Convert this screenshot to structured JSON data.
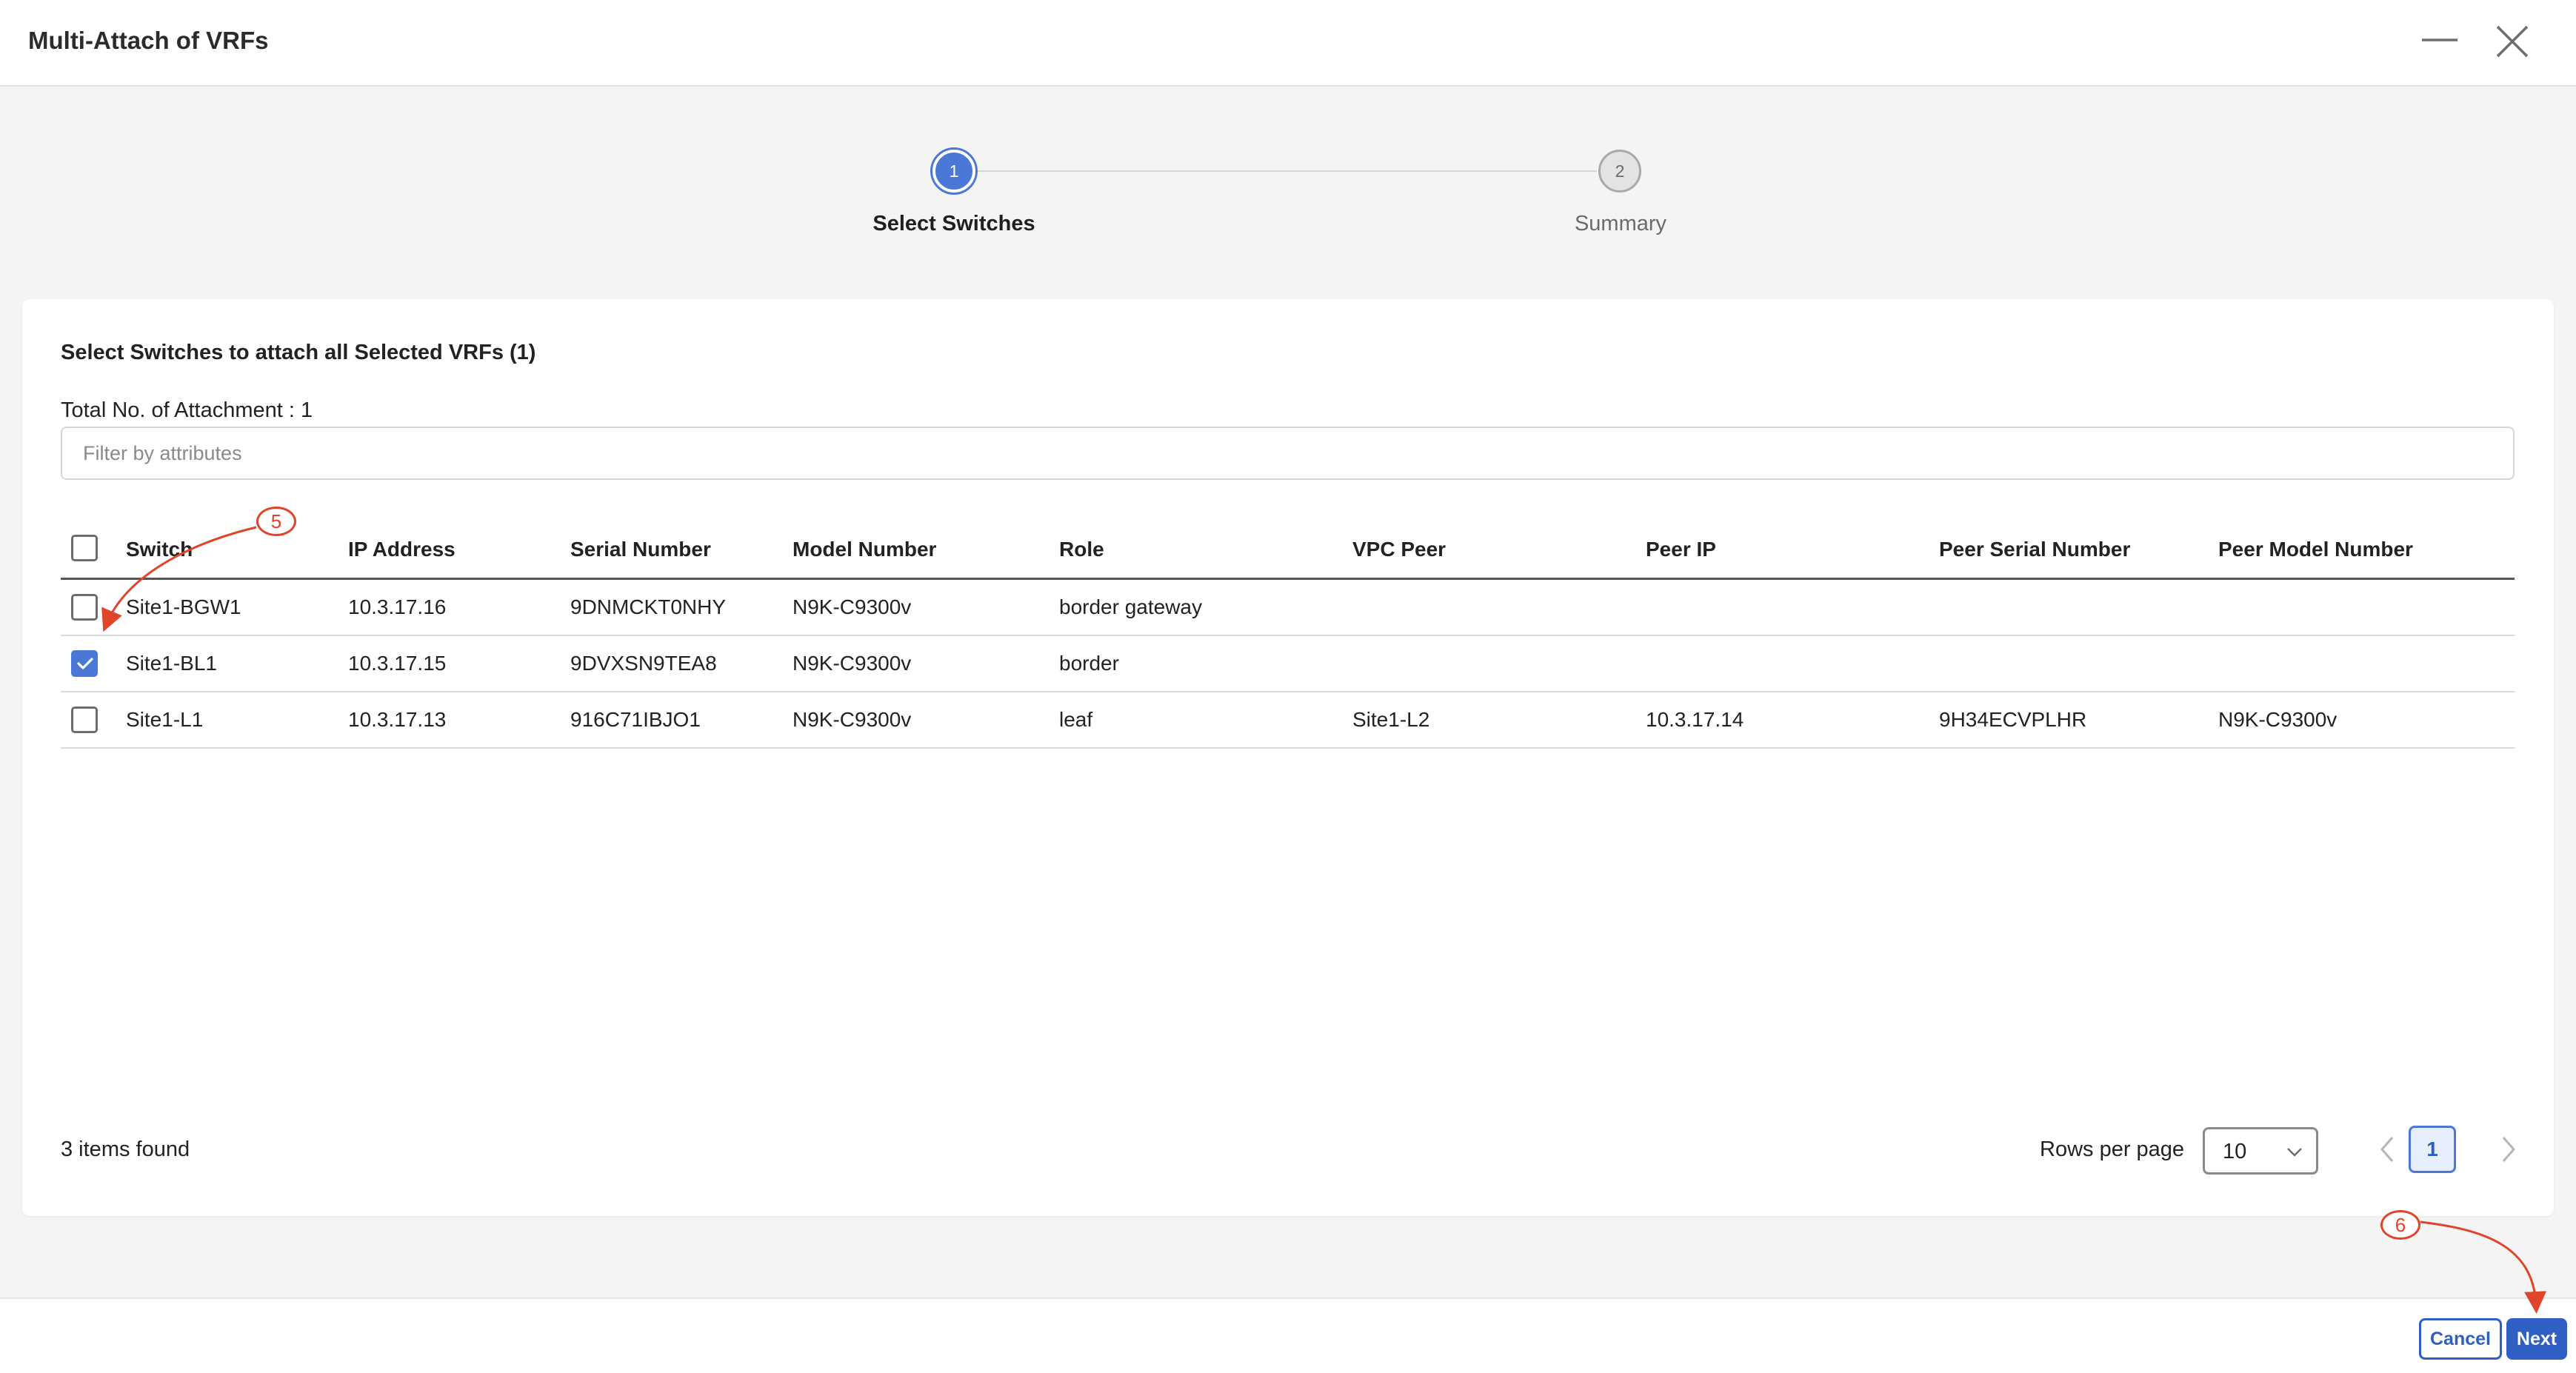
{
  "dialog": {
    "title": "Multi-Attach of VRFs",
    "minimize_icon": "minimize-icon",
    "close_icon": "close-icon"
  },
  "stepper": {
    "steps": [
      {
        "number": "1",
        "label": "Select Switches",
        "state": "active"
      },
      {
        "number": "2",
        "label": "Summary",
        "state": "pending"
      }
    ]
  },
  "panel": {
    "heading": "Select Switches to attach all Selected VRFs (1)",
    "total_attachments": "Total No. of Attachment : 1",
    "filter_placeholder": "Filter by attributes",
    "filter_value": ""
  },
  "table": {
    "columns": [
      "Switch",
      "IP Address",
      "Serial Number",
      "Model Number",
      "Role",
      "VPC Peer",
      "Peer IP",
      "Peer Serial Number",
      "Peer Model Number"
    ],
    "rows": [
      {
        "checked": false,
        "switch": "Site1-BGW1",
        "ip": "10.3.17.16",
        "serial": "9DNMCKT0NHY",
        "model": "N9K-C9300v",
        "role": "border gateway",
        "vpc_peer": "",
        "peer_ip": "",
        "peer_serial": "",
        "peer_model": ""
      },
      {
        "checked": true,
        "switch": "Site1-BL1",
        "ip": "10.3.17.15",
        "serial": "9DVXSN9TEA8",
        "model": "N9K-C9300v",
        "role": "border",
        "vpc_peer": "",
        "peer_ip": "",
        "peer_serial": "",
        "peer_model": ""
      },
      {
        "checked": false,
        "switch": "Site1-L1",
        "ip": "10.3.17.13",
        "serial": "916C71IBJO1",
        "model": "N9K-C9300v",
        "role": "leaf",
        "vpc_peer": "Site1-L2",
        "peer_ip": "10.3.17.14",
        "peer_serial": "9H34ECVPLHR",
        "peer_model": "N9K-C9300v"
      }
    ]
  },
  "pagination": {
    "items_found": "3 items found",
    "rows_per_page_label": "Rows per page",
    "rows_per_page_value": "10",
    "current_page": "1"
  },
  "footer": {
    "cancel_label": "Cancel",
    "next_label": "Next"
  },
  "annotations": {
    "marker_5": "5",
    "marker_6": "6",
    "color": "#e0442a"
  },
  "colors": {
    "accent": "#4b78d6",
    "button_primary": "#2f5fc4"
  }
}
